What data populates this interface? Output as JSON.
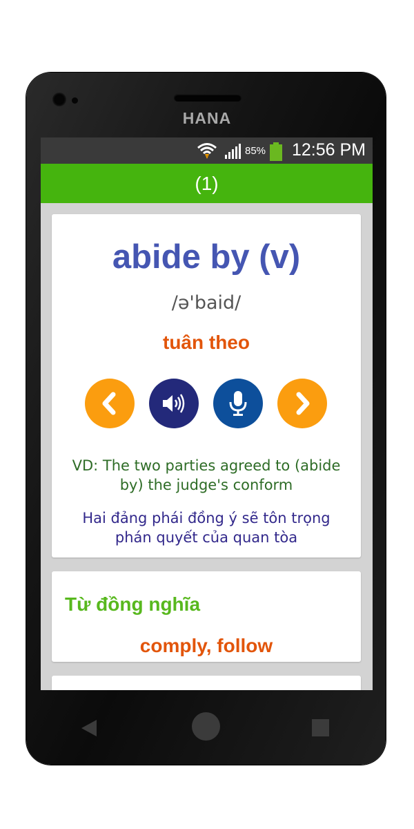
{
  "device": {
    "brand": "HANA"
  },
  "statusbar": {
    "battery_percent": "85%",
    "time": "12:56 PM",
    "icons": [
      "wifi-icon",
      "signal-icon",
      "battery-icon"
    ]
  },
  "appbar": {
    "title": "(1)",
    "color": "#45b40e"
  },
  "word_card": {
    "word": "abide by (v)",
    "phonetic": "/ə'baid/",
    "meaning": "tuân theo",
    "buttons": [
      {
        "icon": "chevron-left-icon",
        "color": "#fb9d0f"
      },
      {
        "icon": "speaker-icon",
        "color": "#23297a"
      },
      {
        "icon": "microphone-icon",
        "color": "#0d4f9b"
      },
      {
        "icon": "chevron-right-icon",
        "color": "#fb9d0f"
      }
    ],
    "example_en": "VD: The two parties agreed to (abide by) the judge's conform",
    "example_vi": "Hai đảng phái đồng ý sẽ tôn trọng phán quyết của quan tòa"
  },
  "synonym_card": {
    "title": "Từ đồng nghĩa",
    "value": "comply, follow"
  },
  "navbar": {
    "icons": [
      "back-icon",
      "home-icon",
      "recent-apps-icon"
    ]
  }
}
